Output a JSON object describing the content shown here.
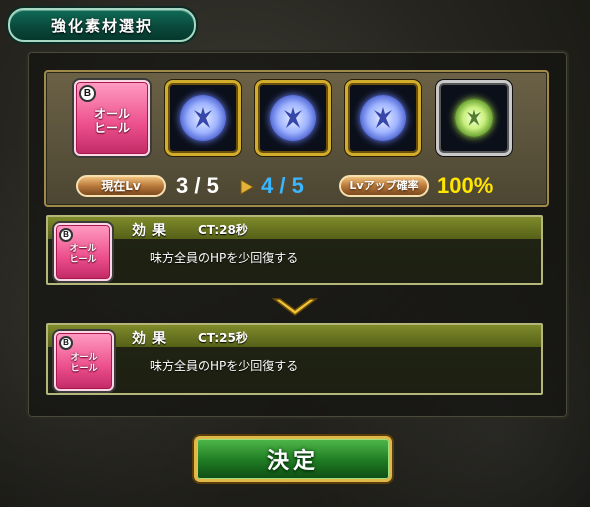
{
  "title": "強化素材選択",
  "target_skill": {
    "badge": "B",
    "line1": "オール",
    "line2": "ヒール"
  },
  "materials": [
    {
      "type": "blue-fairy-orb",
      "frame": "gold"
    },
    {
      "type": "blue-fairy-orb",
      "frame": "gold"
    },
    {
      "type": "blue-fairy-orb",
      "frame": "gold"
    },
    {
      "type": "green-fairy-orb",
      "frame": "silver"
    }
  ],
  "level": {
    "current_label": "現在Lv",
    "current": "3 / 5",
    "next": "4 / 5",
    "success_label": "Lvアップ確率",
    "success_rate": "100%"
  },
  "effect_before": {
    "skill": {
      "badge": "B",
      "line1": "オール",
      "line2": "ヒール"
    },
    "title": "効果",
    "ct": "CT:28秒",
    "description": "味方全員のHPを少回復する"
  },
  "effect_after": {
    "skill": {
      "badge": "B",
      "line1": "オール",
      "line2": "ヒール"
    },
    "title": "効果",
    "ct": "CT:25秒",
    "description": "味方全員のHPを少回復する"
  },
  "confirm_label": "決定",
  "colors": {
    "accent_gold": "#d2ad2c",
    "next_level_blue": "#39b6ff",
    "rate_yellow": "#ffe500",
    "skill_pink": "#ec4f8c"
  }
}
